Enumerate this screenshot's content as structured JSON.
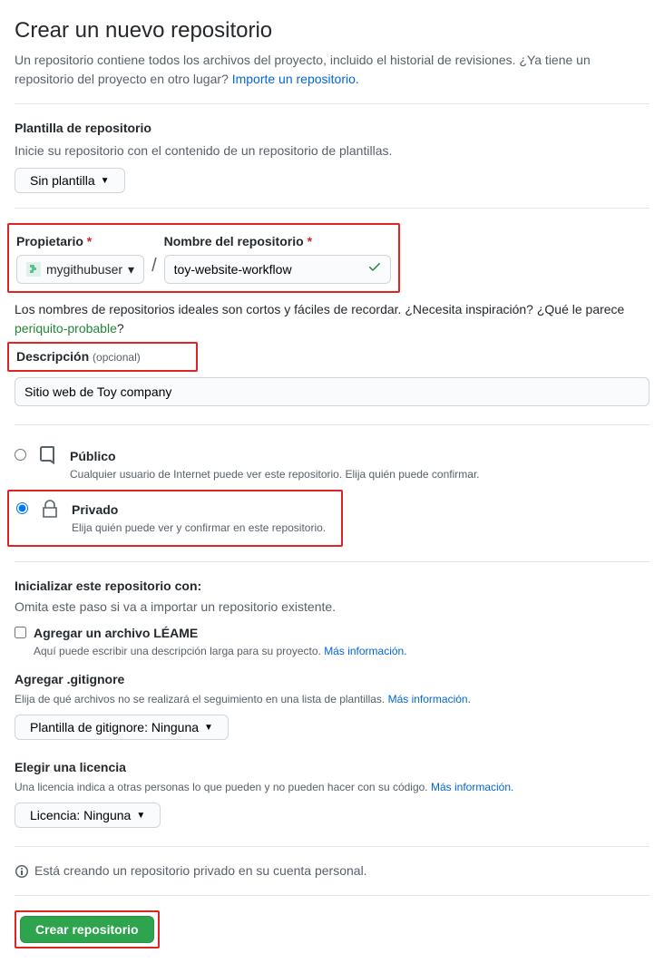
{
  "header": {
    "title": "Crear un nuevo repositorio",
    "subtitle_prefix": "Un repositorio contiene todos los archivos del proyecto, incluido el historial de revisiones. ¿Ya tiene un repositorio del proyecto en otro lugar? ",
    "import_link": "Importe un repositorio."
  },
  "template": {
    "label": "Plantilla de repositorio",
    "help": "Inicie su repositorio con el contenido de un repositorio de plantillas.",
    "button": "Sin plantilla"
  },
  "owner": {
    "label": "Propietario",
    "selected": "mygithubuser"
  },
  "repo": {
    "label": "Nombre del repositorio",
    "value": "toy-website-workflow"
  },
  "name_hint": {
    "text_prefix": "Los nombres de repositorios ideales son cortos y fáciles de recordar. ¿Necesita inspiración? ¿Qué le parece ",
    "suggestion": "periquito-probable",
    "text_suffix": "?"
  },
  "description": {
    "label": "Descripción",
    "optional": "(opcional)",
    "value": "Sitio web de Toy company"
  },
  "visibility": {
    "public": {
      "title": "Público",
      "desc": "Cualquier usuario de Internet puede ver este repositorio. Elija quién puede confirmar."
    },
    "private": {
      "title": "Privado",
      "desc": "Elija quién puede ver y confirmar en este repositorio."
    }
  },
  "initialize": {
    "heading": "Inicializar este repositorio con:",
    "skip_hint": "Omita este paso si va a importar un repositorio existente.",
    "readme": {
      "title": "Agregar un archivo LÉAME",
      "desc_prefix": "Aquí puede escribir una descripción larga para su proyecto. ",
      "more": "Más información."
    }
  },
  "gitignore": {
    "label": "Agregar .gitignore",
    "help_prefix": "Elija de qué archivos no se realizará el seguimiento en una lista de plantillas. ",
    "more": "Más información.",
    "button_prefix": "Plantilla de gitignore: ",
    "button_value": "Ninguna"
  },
  "license": {
    "label": "Elegir una licencia",
    "help_prefix": "Una licencia indica a otras personas lo que pueden y no pueden hacer con su código. ",
    "more": "Más información.",
    "button_prefix": "Licencia: ",
    "button_value": "Ninguna"
  },
  "footer": {
    "info": "Está creando un repositorio privado en su cuenta personal.",
    "submit": "Crear repositorio"
  }
}
